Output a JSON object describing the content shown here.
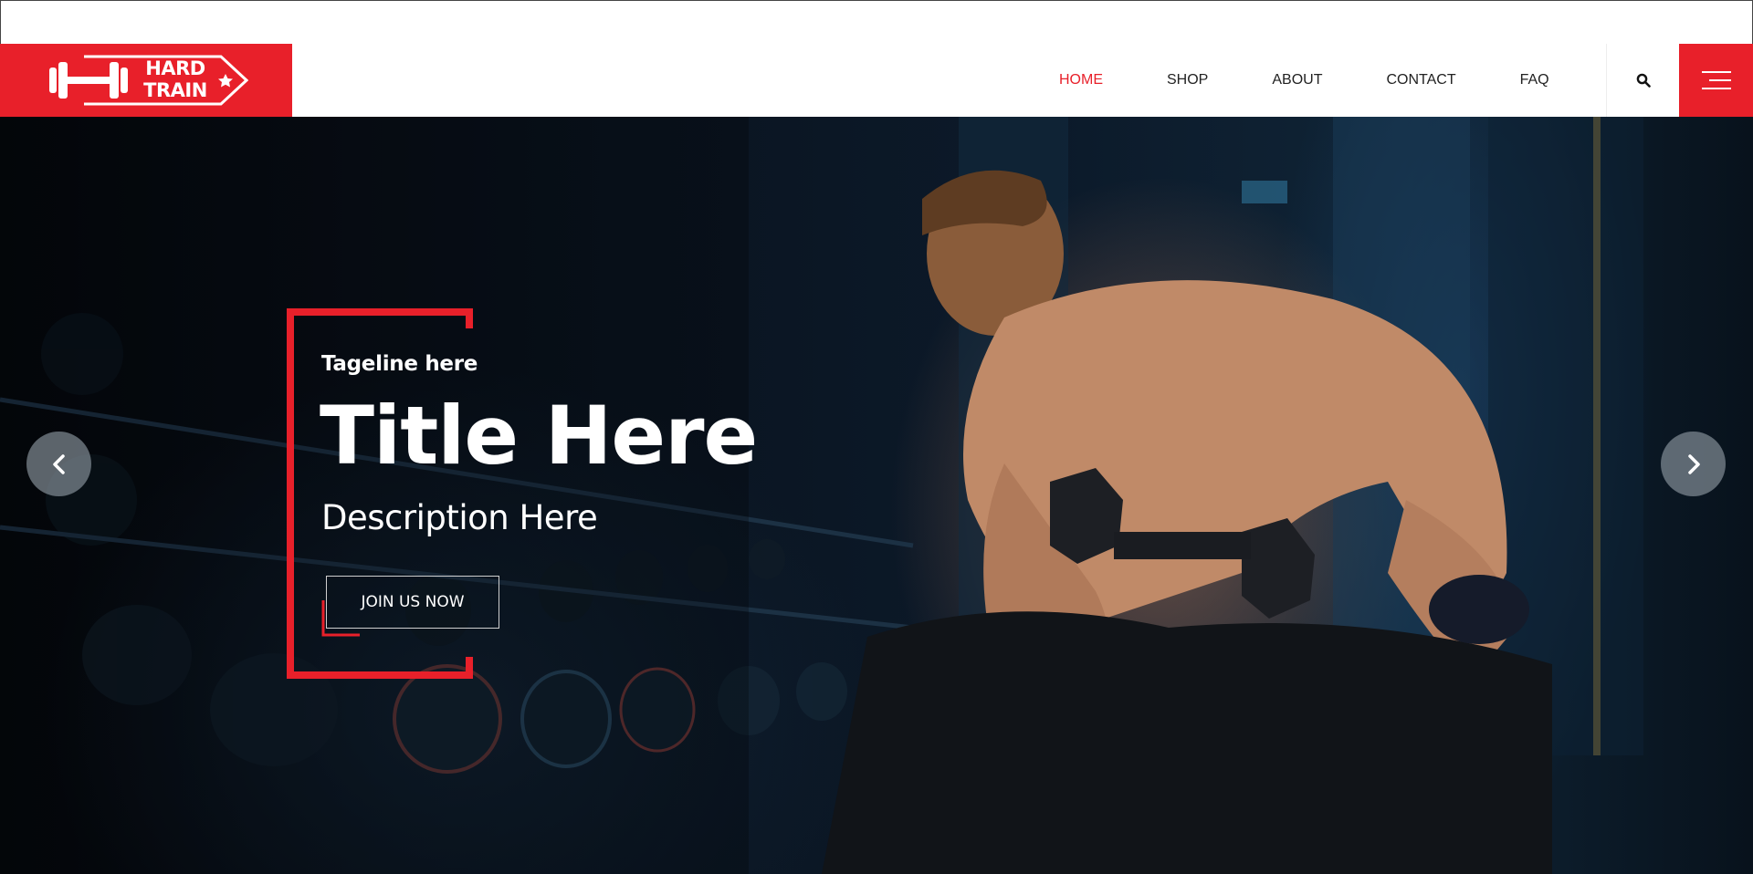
{
  "brand": {
    "logo_line1": "HARD",
    "logo_line2": "TRAIN",
    "accent_color": "#e8202a"
  },
  "nav": {
    "items": [
      {
        "label": "HOME",
        "active": true
      },
      {
        "label": "SHOP",
        "active": false
      },
      {
        "label": "ABOUT",
        "active": false
      },
      {
        "label": "CONTACT",
        "active": false
      },
      {
        "label": "FAQ",
        "active": false
      }
    ],
    "search_icon": "search-icon",
    "menu_icon": "hamburger-menu-icon"
  },
  "hero": {
    "tagline": "Tageline here",
    "title": "Title Here",
    "description": "Description Here",
    "cta_label": "JOIN US NOW",
    "prev_icon": "chevron-left-icon",
    "next_icon": "chevron-right-icon"
  }
}
